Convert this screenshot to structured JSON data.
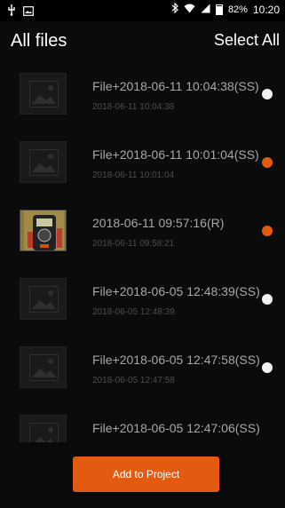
{
  "status_bar": {
    "battery_percent": "82%",
    "time": "10:20",
    "icons": [
      "usb-icon",
      "image-notification-icon",
      "bluetooth-icon",
      "wifi-icon",
      "signal-icon",
      "battery-icon"
    ]
  },
  "header": {
    "title": "All files",
    "select_all_label": "Select All"
  },
  "files": [
    {
      "title": "File+2018-06-11 10:04:38(SS)",
      "subtitle": "2018-06-11 10:04:38",
      "thumbnail": "image-placeholder-icon",
      "selected": false
    },
    {
      "title": "File+2018-06-11 10:01:04(SS)",
      "subtitle": "2018-06-11 10:01:04",
      "thumbnail": "image-placeholder-icon",
      "selected": true
    },
    {
      "title": "2018-06-11 09:57:16(R)",
      "subtitle": "2018-06-11 09:58:21",
      "thumbnail": "photo-thumbnail",
      "selected": true
    },
    {
      "title": "File+2018-06-05 12:48:39(SS)",
      "subtitle": "2018-06-05 12:48:39",
      "thumbnail": "image-placeholder-icon",
      "selected": false
    },
    {
      "title": "File+2018-06-05 12:47:58(SS)",
      "subtitle": "2018-06-05 12:47:58",
      "thumbnail": "image-placeholder-icon",
      "selected": false
    },
    {
      "title": "File+2018-06-05 12:47:06(SS)",
      "subtitle": "",
      "thumbnail": "image-placeholder-icon",
      "selected": false
    }
  ],
  "colors": {
    "accent": "#e35b10",
    "unselected_dot": "#f2f2f2",
    "title_text": "#a7a7a7",
    "subtitle_text": "#4c4c4c"
  },
  "footer": {
    "add_button_label": "Add to Project"
  }
}
